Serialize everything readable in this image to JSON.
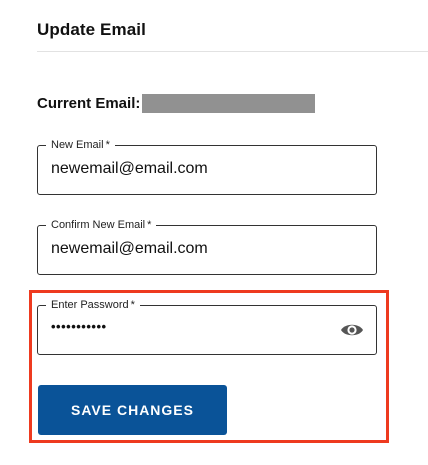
{
  "section": {
    "title": "Update Email"
  },
  "current_email": {
    "label": "Current Email:"
  },
  "fields": {
    "new_email": {
      "label": "New Email",
      "required_mark": "*",
      "value": "newemail@email.com"
    },
    "confirm_email": {
      "label": "Confirm New Email",
      "required_mark": "*",
      "value": "newemail@email.com"
    },
    "password": {
      "label": "Enter Password",
      "required_mark": "*",
      "value": "•••••••••••",
      "toggle_icon": "eye-icon"
    }
  },
  "actions": {
    "save_label": "SAVE CHANGES"
  },
  "colors": {
    "primary_button": "#0a5398",
    "highlight": "#ee3a1f",
    "redacted": "#919191"
  }
}
